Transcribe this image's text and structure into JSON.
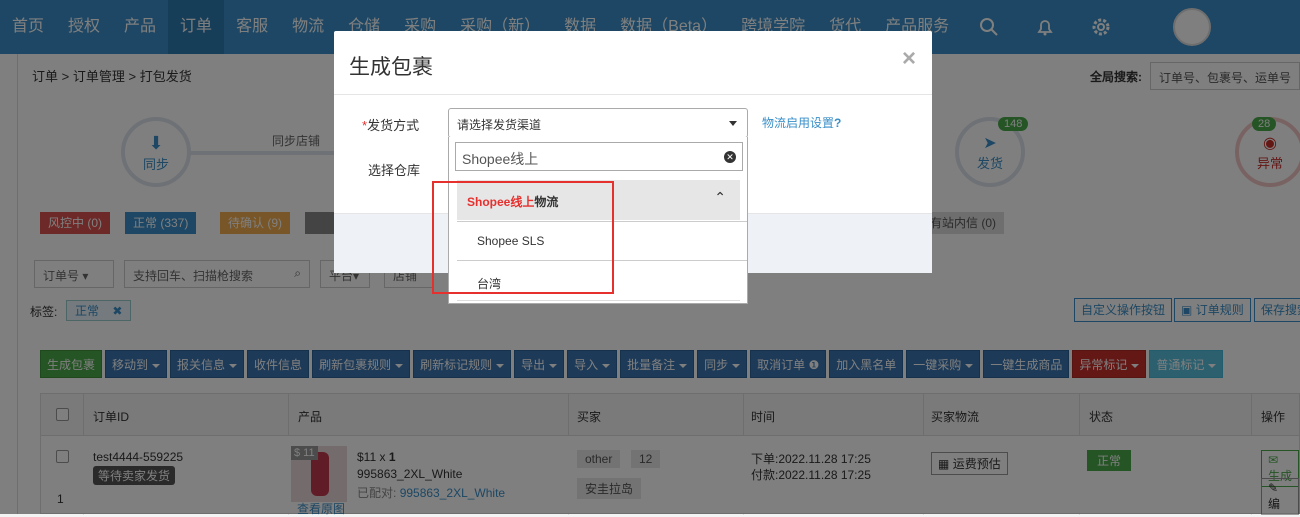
{
  "nav": {
    "items": [
      "首页",
      "授权",
      "产品",
      "订单",
      "客服",
      "物流",
      "仓储",
      "采购",
      "采购（新）",
      "数据",
      "数据（Beta）",
      "跨境学院",
      "货代",
      "产品服务"
    ],
    "active": "订单"
  },
  "breadcrumb": {
    "items": [
      "订单",
      "订单管理",
      "打包发货"
    ]
  },
  "global_search": {
    "label": "全局搜索:",
    "placeholder": "订单号、包裹号、运单号"
  },
  "steps": {
    "s1": "同步",
    "line_label": "同步店铺",
    "ship": "发货",
    "ship_count": "148",
    "abnormal": "异常",
    "abnormal_count": "28"
  },
  "status_tabs": {
    "risk": "风控中 (0)",
    "normal": "正常 (337)",
    "pending": "待确认 (9)",
    "station": "有站内信 (0)"
  },
  "filters": {
    "order_select": "订单号",
    "search_placeholder": "支持回车、扫描枪搜索",
    "platform": "平台",
    "shop": "店铺",
    "tag_label": "标签:",
    "tag_value": "正常"
  },
  "right_buttons": {
    "custom": "自定义操作按钮",
    "rule": "订单规则",
    "save": "保存搜索"
  },
  "actions": [
    "生成包裹",
    "移动到",
    "报关信息",
    "收件信息",
    "刷新包裹规则",
    "刷新标记规则",
    "导出",
    "导入",
    "批量备注",
    "同步",
    "取消订单",
    "加入黑名单",
    "一键采购",
    "一键生成商品",
    "异常标记",
    "普通标记"
  ],
  "table": {
    "headers": {
      "order": "订单ID",
      "product": "产品",
      "buyer": "买家",
      "time": "时间",
      "logistics": "买家物流",
      "status": "状态",
      "ops": "操作"
    },
    "row": {
      "order_id": "test4444-559225",
      "order_status": "等待卖家发货",
      "row_index": "1",
      "price_badge": "$ 11",
      "price": "$11",
      "qty_x": "x",
      "qty": "1",
      "sku": "995863_2XL_White",
      "matched_label": "已配对:",
      "matched_sku": "995863_2XL_White",
      "view_image": "查看原图",
      "buyer_tag": "other",
      "buyer_count": "12",
      "buyer_region": "安圭拉岛",
      "order_time": "下单:2022.11.28 17:25",
      "pay_time": "付款:2022.11.28 17:25",
      "freight": "运费预估",
      "status": "正常",
      "op1": "生成",
      "op2": "编"
    }
  },
  "modal": {
    "title": "生成包裹",
    "close": "×",
    "ship_method_required": "*",
    "ship_method_label": "发货方式",
    "ship_method_placeholder": "请选择发货渠道",
    "logistics_settings": "物流启用设置",
    "help_icon": "?",
    "warehouse_label": "选择仓库",
    "dropdown": {
      "search_value": "Shopee线上",
      "group_highlight": "Shopee线上",
      "group_suffix": "物流",
      "options": [
        "Shopee SLS",
        "台湾"
      ]
    }
  },
  "colors": {
    "nav_bg": "#3a8fc8",
    "highlight_red": "#e5302e",
    "green": "#4aa84a"
  }
}
